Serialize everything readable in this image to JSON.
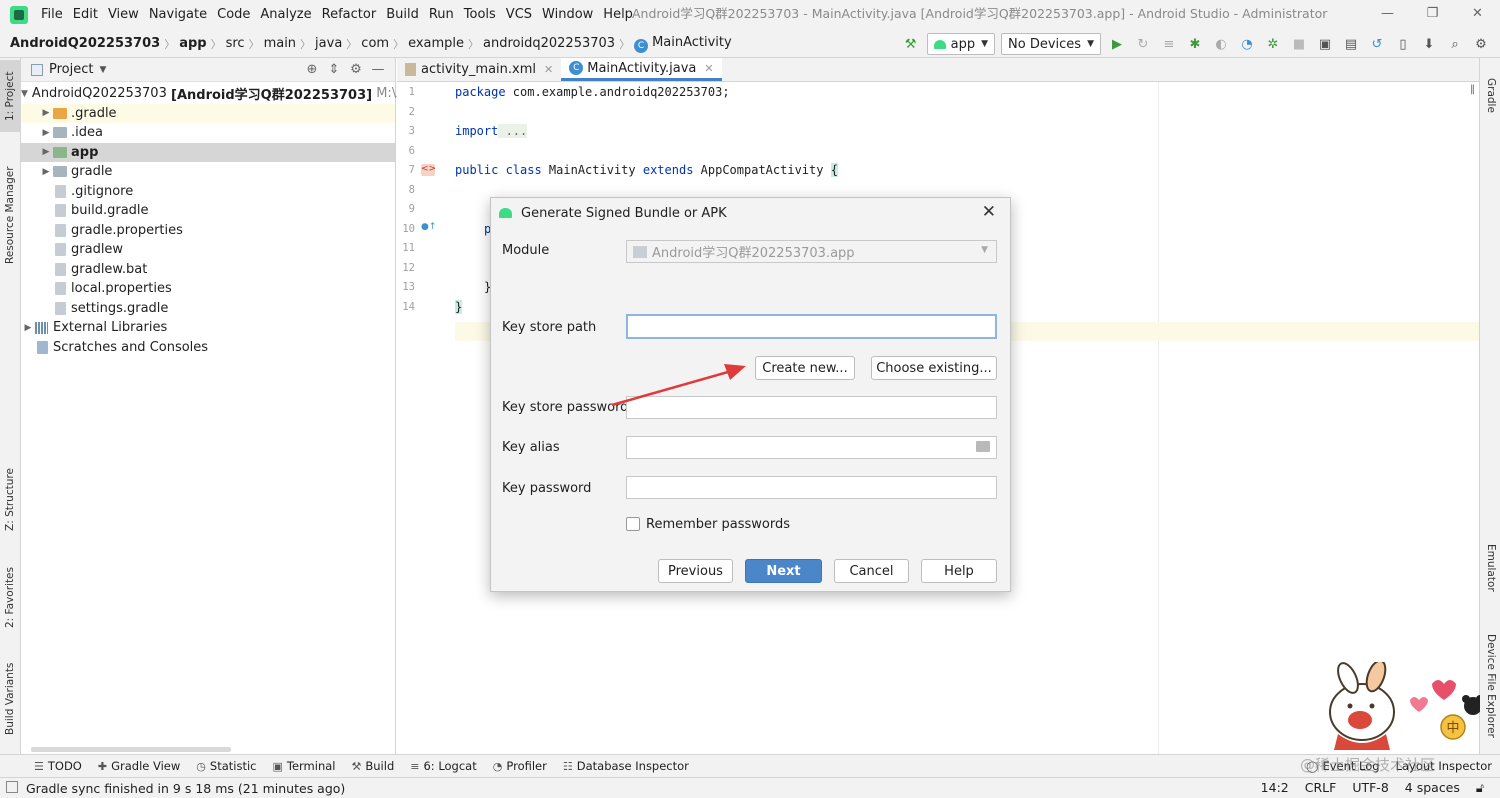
{
  "menubar": {
    "items": [
      "File",
      "Edit",
      "View",
      "Navigate",
      "Code",
      "Analyze",
      "Refactor",
      "Build",
      "Run",
      "Tools",
      "VCS",
      "Window",
      "Help"
    ],
    "window_title": "Android学习Q群202253703 - MainActivity.java [Android学习Q群202253703.app] - Android Studio - Administrator"
  },
  "breadcrumb": [
    "AndroidQ202253703",
    "app",
    "src",
    "main",
    "java",
    "com",
    "example",
    "androidq202253703",
    "MainActivity"
  ],
  "toolbar": {
    "config": "app",
    "device": "No Devices"
  },
  "left_strip": {
    "project": "1: Project",
    "resource_manager": "Resource Manager",
    "structure": "Z: Structure",
    "favorites": "2: Favorites",
    "build_variants": "Build Variants"
  },
  "right_strip": {
    "gradle": "Gradle",
    "emulator": "Emulator",
    "device_explorer": "Device File Explorer"
  },
  "project_panel": {
    "title": "Project",
    "root_name": "AndroidQ202253703",
    "root_module": "[Android学习Q群202253703]",
    "root_path": "M:\\And",
    "items": [
      {
        "label": ".gradle"
      },
      {
        "label": ".idea"
      },
      {
        "label": "app"
      },
      {
        "label": "gradle"
      },
      {
        "label": ".gitignore"
      },
      {
        "label": "build.gradle"
      },
      {
        "label": "gradle.properties"
      },
      {
        "label": "gradlew"
      },
      {
        "label": "gradlew.bat"
      },
      {
        "label": "local.properties"
      },
      {
        "label": "settings.gradle"
      }
    ],
    "external": "External Libraries",
    "scratches": "Scratches and Consoles"
  },
  "editor": {
    "tabs": [
      {
        "label": "activity_main.xml"
      },
      {
        "label": "MainActivity.java"
      }
    ],
    "line_numbers": [
      "1",
      "2",
      "3",
      "6",
      "7",
      "8",
      "9",
      "10",
      "11",
      "12",
      "13",
      "14"
    ],
    "code": {
      "l1_kw": "package",
      "l1_rest": " com.example.androidq202253703;",
      "l3_kw": "import",
      "l3_rest": " ...",
      "l7_kw1": "public class",
      "l7_name": " MainActivity ",
      "l7_kw2": "extends",
      "l7_rest": " AppCompatActivity ",
      "l7_brace": "{",
      "l14_brace": "}",
      "l10_frag": "p",
      "l13_frag": "}"
    }
  },
  "dialog": {
    "title": "Generate Signed Bundle or APK",
    "module_label": "Module",
    "module_value": "Android学习Q群202253703.app",
    "keystore_path_label": "Key store path",
    "keystore_path_value": "",
    "create_new": "Create new...",
    "choose_existing": "Choose existing...",
    "keystore_password_label": "Key store password",
    "key_alias_label": "Key alias",
    "key_password_label": "Key password",
    "remember_label": "Remember passwords",
    "previous": "Previous",
    "next": "Next",
    "cancel": "Cancel",
    "help": "Help"
  },
  "bottom_tools": [
    "TODO",
    "Gradle View",
    "Statistic",
    "Terminal",
    "Build",
    "6: Logcat",
    "Profiler",
    "Database Inspector",
    "Event Log",
    "Layout Inspector"
  ],
  "status": {
    "message": "Gradle sync finished in 9 s 18 ms (21 minutes ago)",
    "position": "14:2",
    "line_sep": "CRLF",
    "encoding": "UTF-8",
    "indent": "4 spaces"
  },
  "watermark": "@稀土掘金技术社区",
  "mascot_badge": "中",
  "colors": {
    "accent": "#4a86c8",
    "keyword": "#0033b3",
    "android_green": "#3ddc84",
    "arrow": "#e03a3a"
  }
}
